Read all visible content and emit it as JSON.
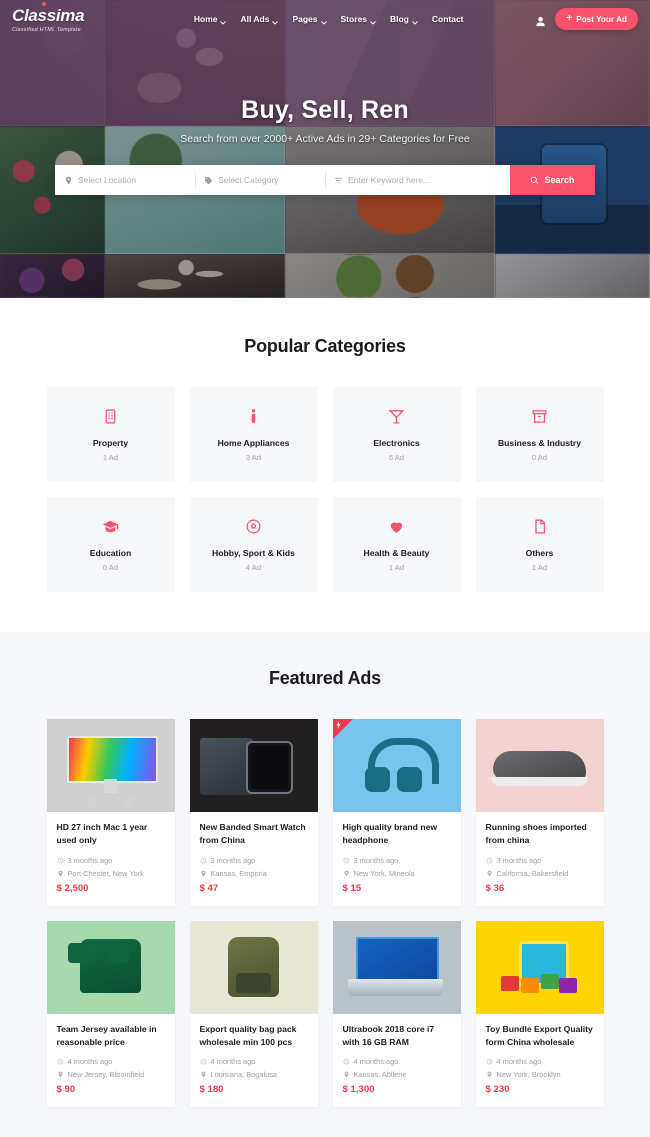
{
  "header": {
    "logo_main": "Classima",
    "logo_sub": "Classified HTML Template",
    "nav": [
      {
        "label": "Home",
        "has_chevron": true
      },
      {
        "label": "All Ads",
        "has_chevron": true
      },
      {
        "label": "Pages",
        "has_chevron": true
      },
      {
        "label": "Stores",
        "has_chevron": true
      },
      {
        "label": "Blog",
        "has_chevron": true
      },
      {
        "label": "Contact",
        "has_chevron": false
      }
    ],
    "post_ad_label": "Post Your Ad",
    "accent_color": "#f9526b"
  },
  "hero": {
    "title": "Buy, Sell, Ren",
    "subtitle": "Search from over 2000+ Active Ads in 29+ Categories for Free",
    "search": {
      "location_placeholder": "Select Location",
      "category_placeholder": "Select Category",
      "keyword_placeholder": "Enter Keyword here...",
      "button_label": "Search"
    }
  },
  "categories": {
    "title": "Popular Categories",
    "items": [
      {
        "name": "Property",
        "count": "1 Ad",
        "icon": "building-icon"
      },
      {
        "name": "Home Appliances",
        "count": "3 Ad",
        "icon": "person-icon"
      },
      {
        "name": "Electronics",
        "count": "6 Ad",
        "icon": "cocktail-icon"
      },
      {
        "name": "Business & Industry",
        "count": "0 Ad",
        "icon": "box-icon"
      },
      {
        "name": "Education",
        "count": "0 Ad",
        "icon": "graduation-cap-icon"
      },
      {
        "name": "Hobby, Sport & Kids",
        "count": "4 Ad",
        "icon": "soccer-ball-icon"
      },
      {
        "name": "Health & Beauty",
        "count": "1 Ad",
        "icon": "heart-icon"
      },
      {
        "name": "Others",
        "count": "1 Ad",
        "icon": "document-icon"
      }
    ]
  },
  "featured": {
    "title": "Featured Ads",
    "ads": [
      {
        "title": "HD 27 inch Mac 1 year used only",
        "time": "3 months ago",
        "location": "Port Chester, New York",
        "price": "$ 2,500",
        "featured_badge": false,
        "art": "imac"
      },
      {
        "title": "New Banded Smart Watch from China",
        "time": "3 months ago",
        "location": "Kansas, Emporia",
        "price": "$ 47",
        "featured_badge": false,
        "art": "watch"
      },
      {
        "title": "High quality brand new headphone",
        "time": "3 months ago",
        "location": "New York, Mineola",
        "price": "$ 15",
        "featured_badge": true,
        "art": "hphone"
      },
      {
        "title": "Running shoes imported from china",
        "time": "3 months ago",
        "location": "California, Bakersfield",
        "price": "$ 36",
        "featured_badge": false,
        "art": "shoe"
      },
      {
        "title": "Team Jersey available in reasonable price",
        "time": "4 months ago",
        "location": "New Jersey, Bloomfield",
        "price": "$ 90",
        "featured_badge": false,
        "art": "jersey"
      },
      {
        "title": "Export quality bag pack wholesale min 100 pcs",
        "time": "4 months ago",
        "location": "Louisiana, Bogalusa",
        "price": "$ 180",
        "featured_badge": false,
        "art": "bag"
      },
      {
        "title": "Ultrabook 2018 core i7 with 16 GB RAM",
        "time": "4 months ago",
        "location": "Kansas, Abilene",
        "price": "$ 1,300",
        "featured_badge": false,
        "art": "laptop"
      },
      {
        "title": "Toy Bundle Export Quality form China wholesale",
        "time": "4 months ago",
        "location": "New York, Brooklyn",
        "price": "$ 230",
        "featured_badge": false,
        "art": "toys"
      }
    ]
  }
}
